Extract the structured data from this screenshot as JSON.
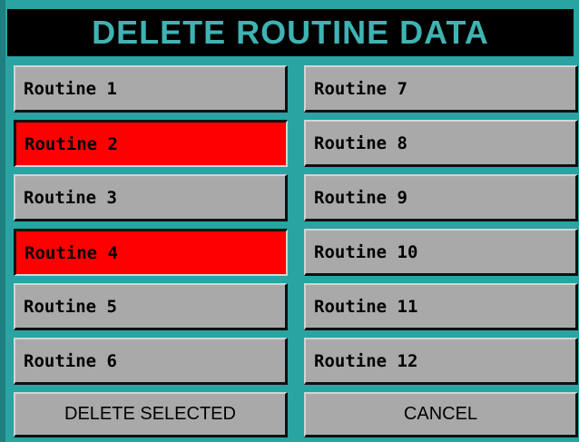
{
  "title": "DELETE ROUTINE DATA",
  "colors": {
    "background": "#2aa3a3",
    "title_bar": "#000000",
    "title_text": "#3fb3b3",
    "button": "#a9a9a9",
    "selected": "#ff0000"
  },
  "routines_left": [
    {
      "label": "Routine 1",
      "selected": false
    },
    {
      "label": "Routine 2",
      "selected": true
    },
    {
      "label": "Routine 3",
      "selected": false
    },
    {
      "label": "Routine 4",
      "selected": true
    },
    {
      "label": "Routine 5",
      "selected": false
    },
    {
      "label": "Routine 6",
      "selected": false
    }
  ],
  "routines_right": [
    {
      "label": "Routine 7",
      "selected": false
    },
    {
      "label": "Routine 8",
      "selected": false
    },
    {
      "label": "Routine 9",
      "selected": false
    },
    {
      "label": "Routine 10",
      "selected": false
    },
    {
      "label": "Routine 11",
      "selected": false
    },
    {
      "label": "Routine 12",
      "selected": false
    }
  ],
  "actions": {
    "delete_label": "DELETE SELECTED",
    "cancel_label": "CANCEL"
  }
}
